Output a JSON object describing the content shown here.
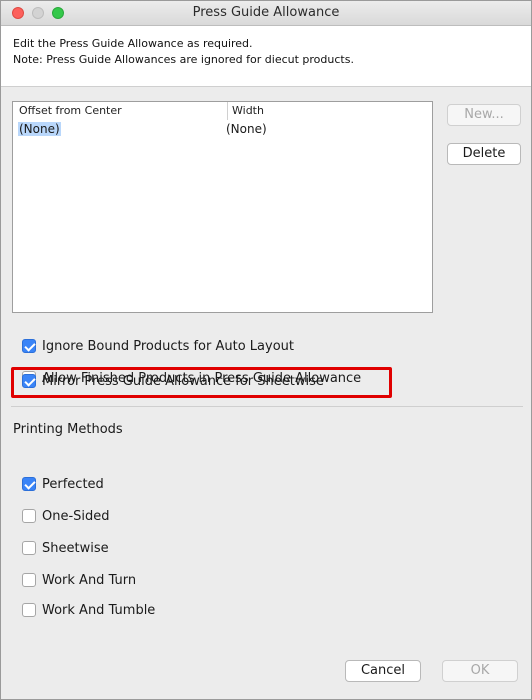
{
  "window": {
    "title": "Press Guide Allowance"
  },
  "header": {
    "line1": "Edit the Press Guide Allowance as required.",
    "line2": "Note: Press Guide Allowances are ignored for diecut products."
  },
  "table": {
    "columns": [
      "Offset from Center",
      "Width"
    ],
    "rows": [
      {
        "offset": "(None)",
        "width": "(None)"
      }
    ]
  },
  "buttons": {
    "new": "New...",
    "delete": "Delete",
    "cancel": "Cancel",
    "ok": "OK"
  },
  "options": [
    {
      "label": "Ignore Bound Products for Auto Layout",
      "checked": true
    },
    {
      "label": "Allow Finished Products in Press Guide Allowance",
      "checked": false
    },
    {
      "label": "Mirror Press Guide Allowance for Sheetwise",
      "checked": true
    }
  ],
  "printing_methods": {
    "title": "Printing Methods",
    "items": [
      {
        "label": "Perfected",
        "checked": true
      },
      {
        "label": "One-Sided",
        "checked": false
      },
      {
        "label": "Sheetwise",
        "checked": false
      },
      {
        "label": "Work And Turn",
        "checked": false
      },
      {
        "label": "Work And Tumble",
        "checked": false
      }
    ]
  },
  "colors": {
    "accent": "#3a84f7",
    "highlight": "#e00000"
  }
}
